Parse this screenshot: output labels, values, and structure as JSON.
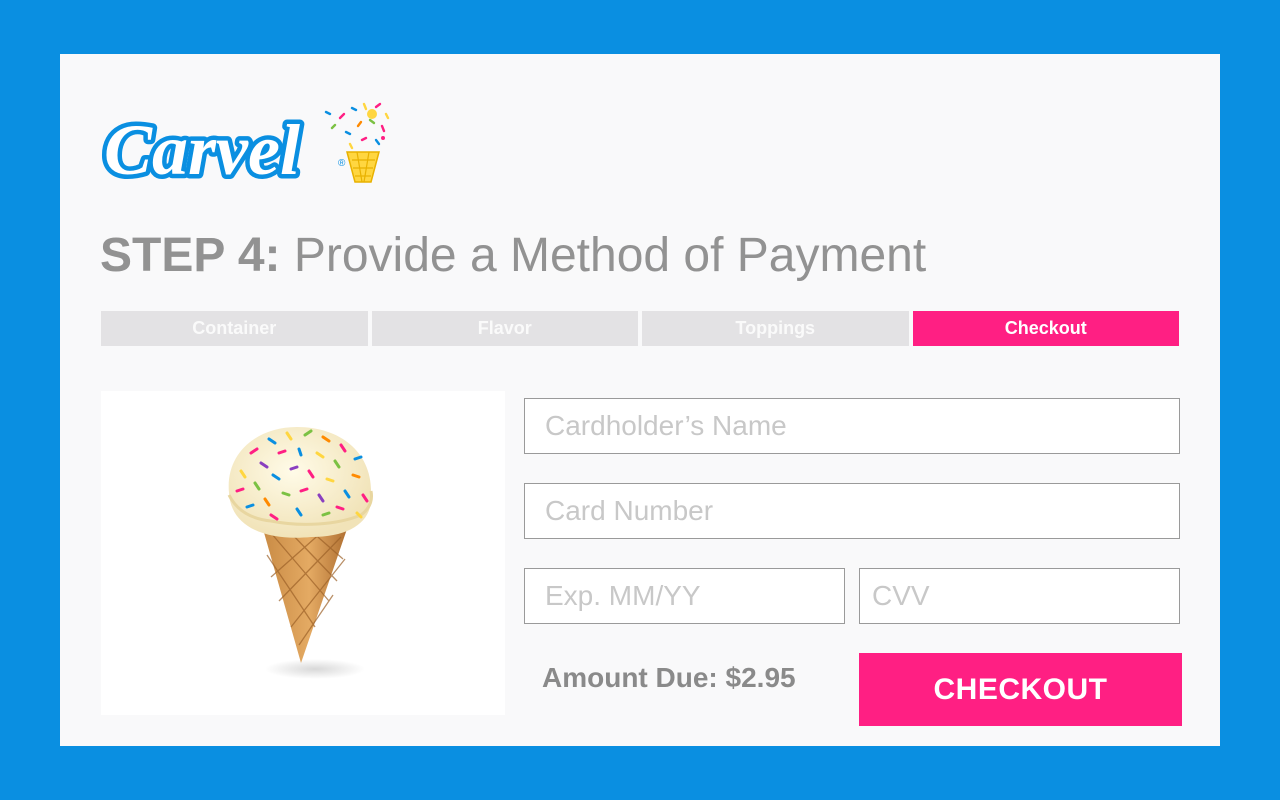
{
  "brand": {
    "name": "Carvel",
    "logo_icon": "ice-cream-cone-sprinkles-icon",
    "color": "#0a8fe1"
  },
  "page": {
    "step_label": "STEP 4:",
    "step_title": "Provide a Method of Payment"
  },
  "steps": [
    {
      "label": "Container",
      "active": false
    },
    {
      "label": "Flavor",
      "active": false
    },
    {
      "label": "Toppings",
      "active": false
    },
    {
      "label": "Checkout",
      "active": true
    }
  ],
  "product": {
    "image": "ice-cream-cone-with-rainbow-sprinkles"
  },
  "form": {
    "cardholder_placeholder": "Cardholder’s Name",
    "card_number_placeholder": "Card Number",
    "expiry_placeholder": "Exp. MM/YY",
    "cvv_placeholder": "CVV"
  },
  "summary": {
    "amount_label": "Amount Due: $2.95"
  },
  "actions": {
    "checkout_label": "CHECKOUT"
  },
  "colors": {
    "accent": "#ff1f83",
    "frame": "#0a8fe1",
    "muted_text": "#929292",
    "inactive_tab": "#e3e2e4"
  }
}
